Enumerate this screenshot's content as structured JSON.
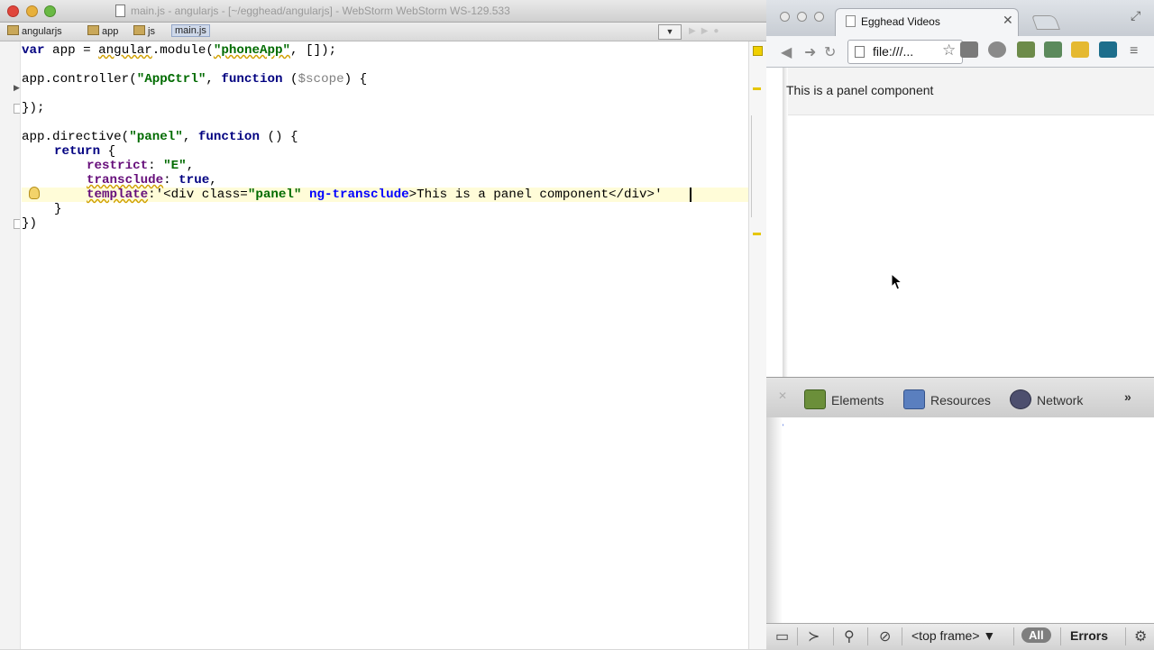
{
  "ide": {
    "window_title": "main.js - angularjs - [~/egghead/angularjs] - WebStorm WebStorm WS-129.533",
    "breadcrumbs": [
      "angularjs",
      "app",
      "js",
      "main.js"
    ],
    "code_lines": [
      "var app = angular.module(\"phoneApp\", []);",
      "app.controller(\"AppCtrl\", function ($scope) {",
      "});",
      "app.directive(\"panel\", function () {",
      "return {",
      "restrict: \"E\",",
      "transclude: true,",
      "template:'<div class=\"panel\" ng-transclude>This is a panel component</div>'",
      "}",
      "})"
    ],
    "tokens": {
      "l1_a": "var",
      "l1_b": " app = ",
      "l1_c": "angular",
      "l1_d": ".module(",
      "l1_e": "\"phoneApp\"",
      "l1_f": ", []);",
      "l2_a": "app.controller(",
      "l2_b": "\"AppCtrl\"",
      "l2_c": ", ",
      "l2_d": "function",
      "l2_e": " (",
      "l2_f": "$scope",
      "l2_g": ") {",
      "l3": "});",
      "l4_a": "app.directive(",
      "l4_b": "\"panel\"",
      "l4_c": ", ",
      "l4_d": "function",
      "l4_e": " () {",
      "l5_a": "return",
      "l5_b": " {",
      "l6_a": "restrict",
      "l6_b": ": ",
      "l6_c": "\"E\"",
      "l6_d": ",",
      "l7_a": "transclude",
      "l7_b": ": ",
      "l7_c": "true",
      "l7_d": ",",
      "l8_a": "template",
      "l8_b": ":",
      "l8_c": "'<div class=",
      "l8_d": "\"panel\"",
      "l8_e": " ",
      "l8_f": "ng-transclude",
      "l8_g": ">This is a panel component</div>'",
      "l9": "}",
      "l10": "})"
    }
  },
  "browser": {
    "tab_title": "Egghead Videos",
    "address": "file:///...",
    "page_text": "This is a panel component",
    "devtools": {
      "tabs": [
        "Elements",
        "Resources",
        "Network"
      ],
      "more": "»",
      "frame": "<top frame>",
      "filter_all": "All",
      "filter_errors": "Errors",
      "console_prompt": "❯"
    }
  },
  "colors": {
    "keyword": "#000080",
    "string": "#006b00",
    "property": "#660e7a",
    "attribute": "#0000ff",
    "current_line": "#fffcd8"
  },
  "icons": [
    "close-icon",
    "minimize-icon",
    "zoom-icon",
    "folder-icon",
    "lightbulb-icon",
    "back-icon",
    "forward-icon",
    "reload-icon",
    "star-icon",
    "menu-icon",
    "search-icon",
    "block-icon",
    "gear-icon",
    "console-icon",
    "dock-icon",
    "cursor-icon"
  ]
}
